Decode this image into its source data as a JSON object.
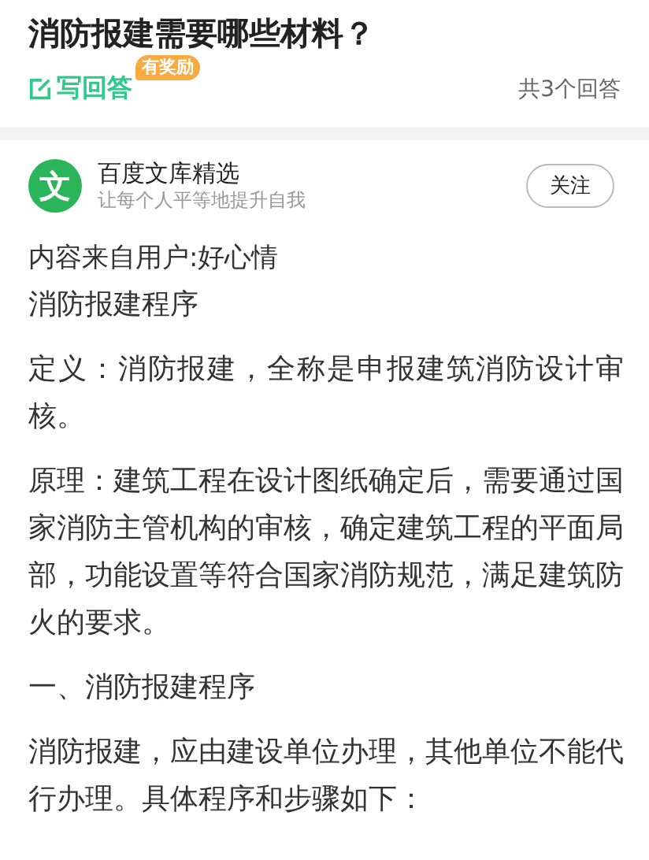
{
  "question": {
    "title": "消防报建需要哪些材料？",
    "write_answer": "写回答",
    "reward_badge": "有奖励",
    "answer_count": "共3个回答"
  },
  "answer": {
    "author": {
      "logo_char": "文",
      "name": "百度文库精选",
      "slogan": "让每个人平等地提升自我",
      "follow_button": "关注"
    },
    "source_note": "内容来自用户:好心情",
    "paragraphs": [
      "消防报建程序",
      "定义：消防报建，全称是申报建筑消防设计审核。",
      "原理：建筑工程在设计图纸确定后，需要通过国家消防主管机构的审核，确定建筑工程的平面局部，功能设置等符合国家消防规范，满足建筑防火的要求。",
      "一、消防报建程序",
      "消防报建，应由建设单位办理，其他单位不能代行办理。具体程序和步骤如下："
    ]
  }
}
